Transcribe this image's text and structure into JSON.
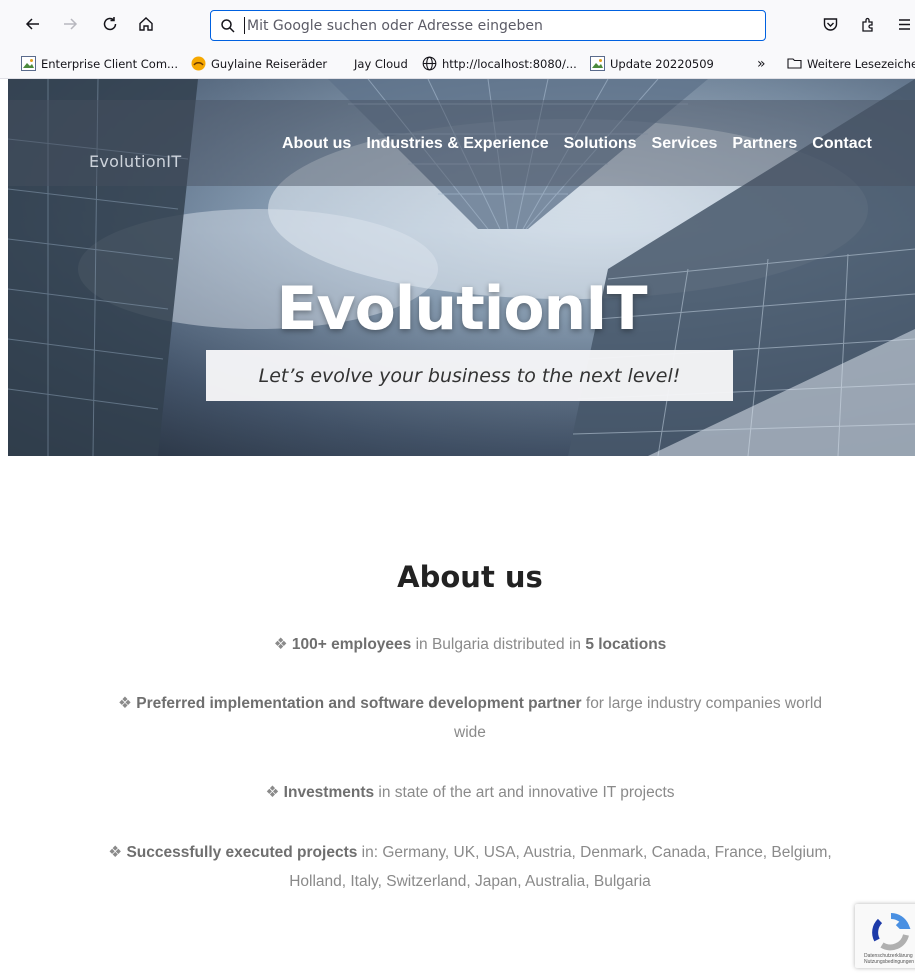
{
  "browser": {
    "address_placeholder": "Mit Google suchen oder Adresse eingeben",
    "bookmarks": [
      {
        "label": "Enterprise Client Com...",
        "icon": "image-favicon"
      },
      {
        "label": "Guylaine Reiseräder",
        "icon": "bike-favicon"
      },
      {
        "label": "Jay Cloud",
        "icon": "none"
      },
      {
        "label": "http://localhost:8080/...",
        "icon": "globe-icon"
      },
      {
        "label": "Update 20220509",
        "icon": "image-favicon"
      }
    ],
    "overflow_label": "»",
    "other_bookmarks_label": "Weitere Lesezeichen"
  },
  "site": {
    "brand": "EvolutionIT",
    "nav": [
      "About us",
      "Industries & Experience",
      "Solutions",
      "Services",
      "Partners",
      "Contact"
    ],
    "hero_title": "EvolutionIT",
    "tagline": "Let’s evolve your business to the next level!"
  },
  "about": {
    "title": "About us",
    "p1": {
      "b1": "100+ employees",
      "t1": " in Bulgaria distributed in ",
      "b2": "5 locations"
    },
    "p2": {
      "b1": "Preferred implementation and software development partner",
      "t1": " for large industry companies world",
      "t2": "wide"
    },
    "p3": {
      "b1": "Investments",
      "t1": " in state of the art and innovative IT projects"
    },
    "p4": {
      "b1": "Successfully executed projects",
      "t1": " in: Germany, UK, USA, Austria, Denmark, Canada, France, Belgium,",
      "t2": "Holland, Italy, Switzerland, Japan, Australia, Bulgaria"
    },
    "bullet": "❖"
  },
  "recaptcha": {
    "line1": "Datenschutzerklärung",
    "line2": "Nutzungsbedingungen"
  },
  "colors": {
    "accent": "#0061e0",
    "text_muted": "#8a8a8a",
    "heading": "#222222"
  }
}
